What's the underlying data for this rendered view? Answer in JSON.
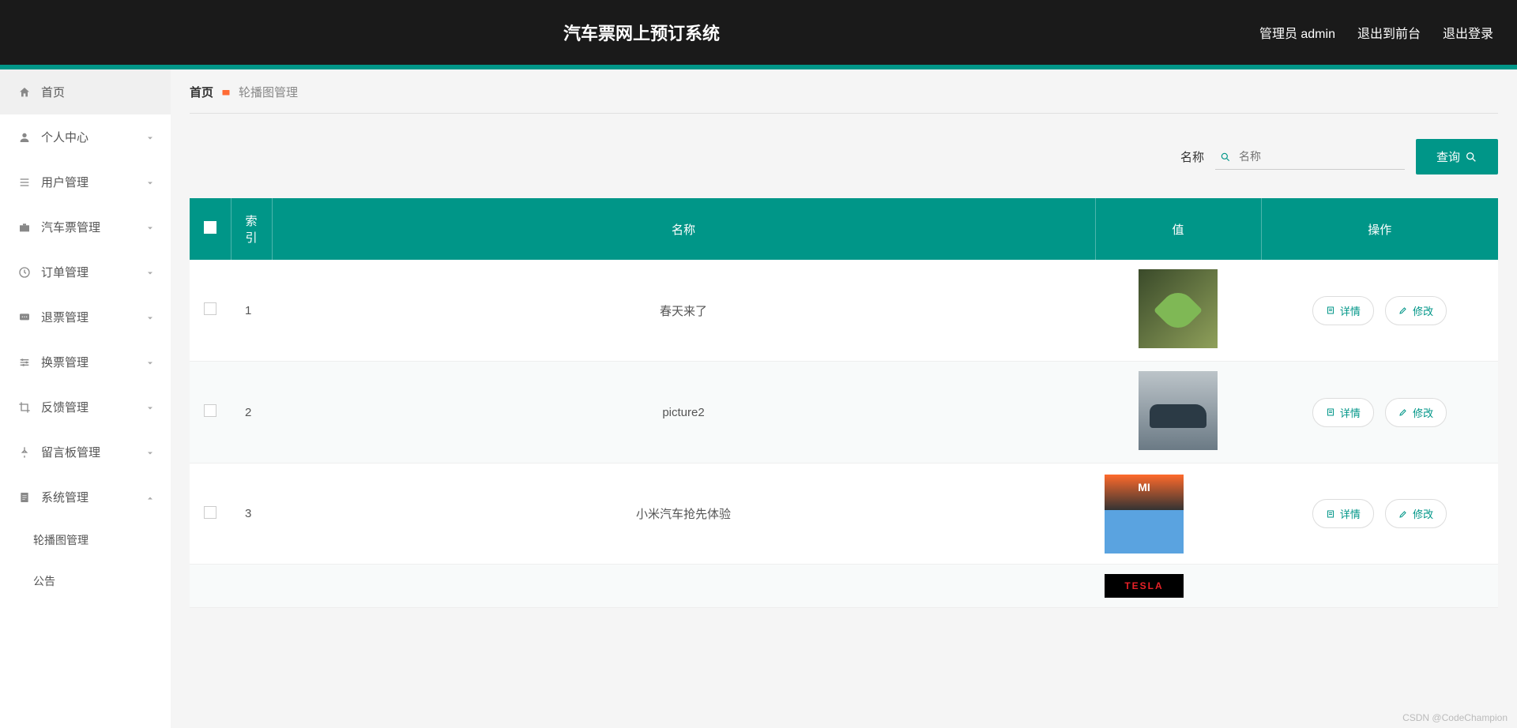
{
  "header": {
    "title": "汽车票网上预订系统",
    "user_label": "管理员 admin",
    "logout_front": "退出到前台",
    "logout": "退出登录"
  },
  "sidebar": {
    "items": [
      {
        "label": "首页",
        "name": "home",
        "expandable": false
      },
      {
        "label": "个人中心",
        "name": "profile",
        "expandable": true
      },
      {
        "label": "用户管理",
        "name": "users",
        "expandable": true
      },
      {
        "label": "汽车票管理",
        "name": "tickets",
        "expandable": true
      },
      {
        "label": "订单管理",
        "name": "orders",
        "expandable": true
      },
      {
        "label": "退票管理",
        "name": "refunds",
        "expandable": true
      },
      {
        "label": "换票管理",
        "name": "exchange",
        "expandable": true
      },
      {
        "label": "反馈管理",
        "name": "feedback",
        "expandable": true
      },
      {
        "label": "留言板管理",
        "name": "messages",
        "expandable": true
      },
      {
        "label": "系统管理",
        "name": "system",
        "expandable": true,
        "expanded": true
      }
    ],
    "subitems": [
      {
        "label": "轮播图管理",
        "name": "carousel"
      },
      {
        "label": "公告",
        "name": "announcement"
      }
    ]
  },
  "breadcrumb": {
    "first": "首页",
    "last": "轮播图管理"
  },
  "search": {
    "label": "名称",
    "placeholder": "名称",
    "button": "查询"
  },
  "table": {
    "header": {
      "check": "",
      "index": "索引",
      "name": "名称",
      "value": "值",
      "ops": "操作"
    },
    "rows": [
      {
        "index": "1",
        "name": "春天来了",
        "thumb": "leaf"
      },
      {
        "index": "2",
        "name": "picture2",
        "thumb": "car"
      },
      {
        "index": "3",
        "name": "小米汽车抢先体验",
        "thumb": "mi"
      }
    ],
    "actions": {
      "detail": "详情",
      "edit": "修改"
    },
    "mi_text": "MI",
    "tesla_text": "TESLA"
  },
  "watermark": "CSDN @CodeChampion"
}
